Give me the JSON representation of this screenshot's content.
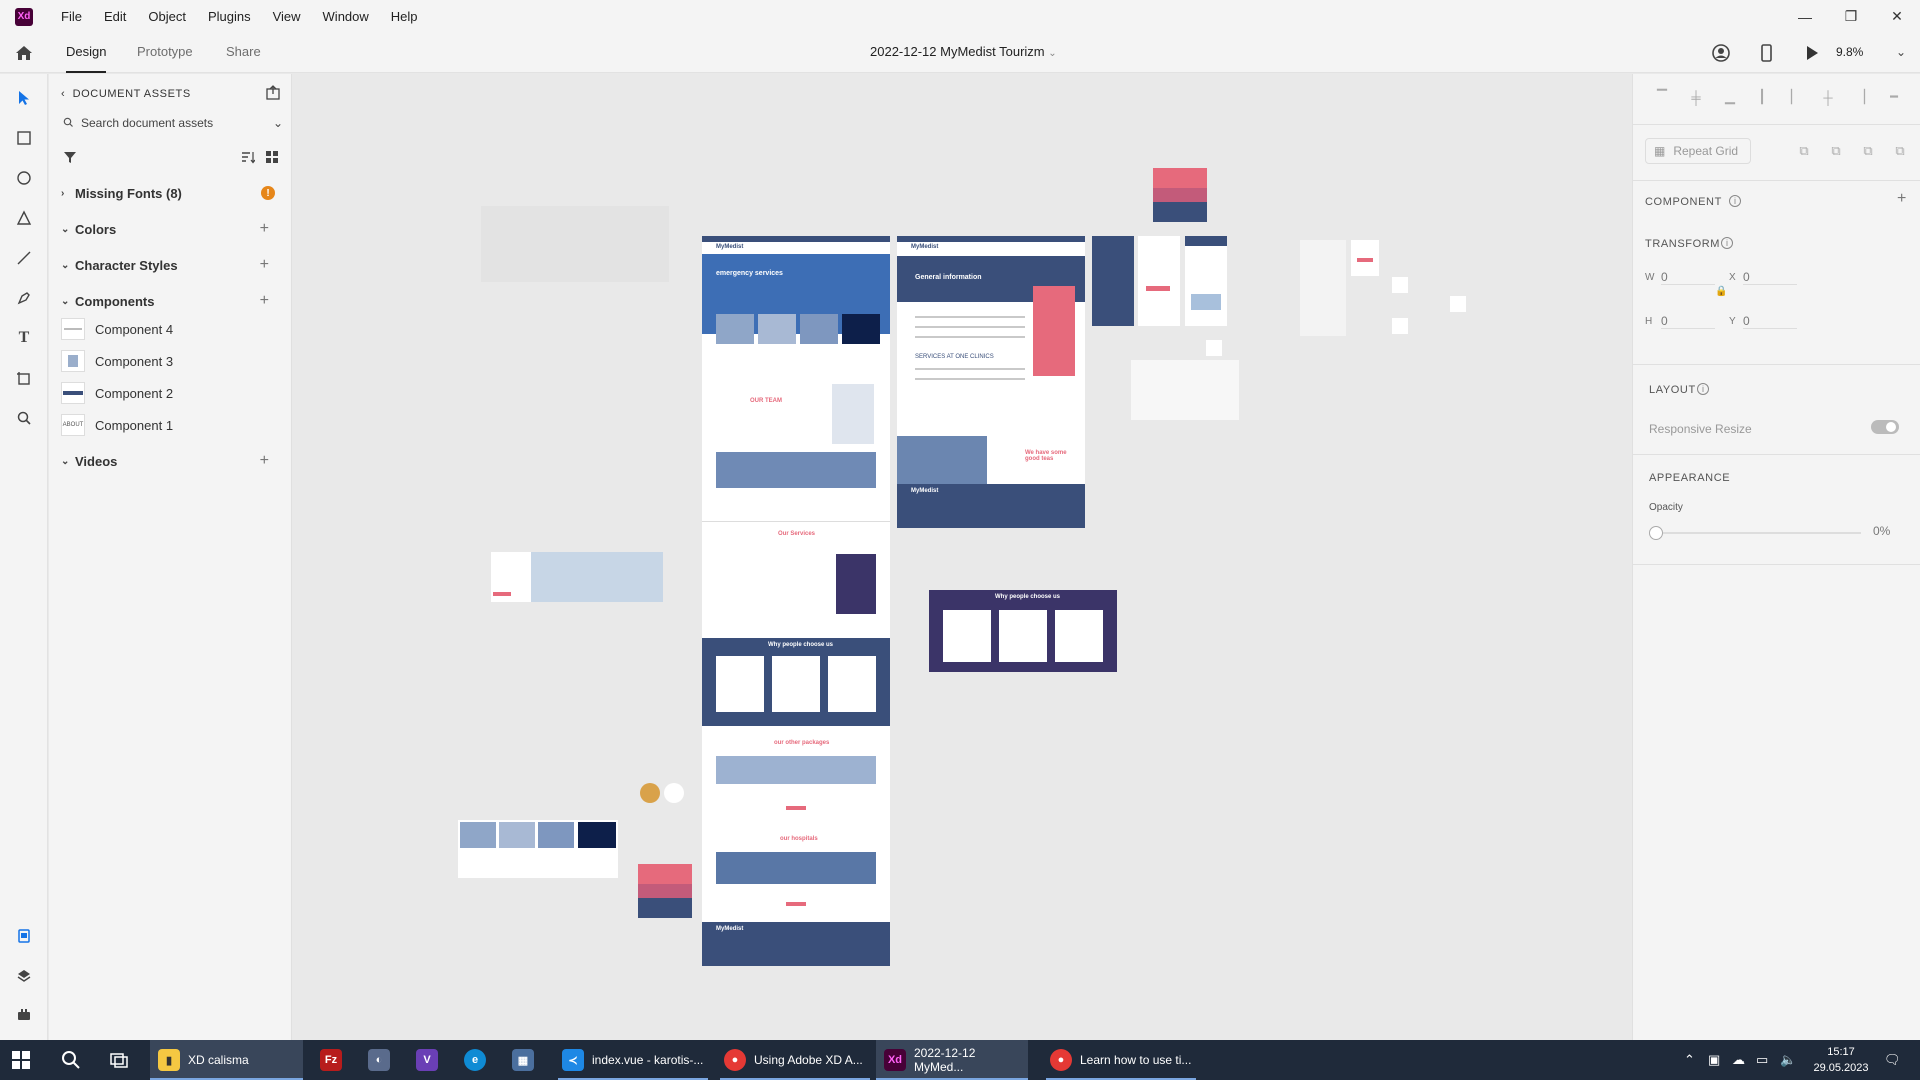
{
  "app": {
    "logo_text": "Xd",
    "menus": [
      "File",
      "Edit",
      "Object",
      "Plugins",
      "View",
      "Window",
      "Help"
    ],
    "window_controls": {
      "minimize": "—",
      "restore": "❐",
      "close": "✕"
    }
  },
  "topbar": {
    "tabs": [
      {
        "label": "Design",
        "active": true
      },
      {
        "label": "Prototype",
        "active": false
      },
      {
        "label": "Share",
        "active": false
      }
    ],
    "document_title": "2022-12-12 MyMedist Tourizm",
    "zoom": "9.8%"
  },
  "assets": {
    "header": "DOCUMENT ASSETS",
    "search_placeholder": "Search document assets",
    "missing_fonts": "Missing Fonts (8)",
    "sections": {
      "colors": "Colors",
      "character_styles": "Character Styles",
      "components": "Components",
      "videos": "Videos"
    },
    "components": [
      {
        "label": "Component 4",
        "thumb": ""
      },
      {
        "label": "Component 3",
        "thumb": ""
      },
      {
        "label": "Component 2",
        "thumb": ""
      },
      {
        "label": "Component 1",
        "thumb": "ABOUT"
      }
    ]
  },
  "canvas": {
    "artboard_texts": {
      "brand": "MyMedist",
      "emergency": "emergency services",
      "our_team": "OUR TEAM",
      "our_services": "Our Services",
      "why_choose": "Why people choose us",
      "other_packages": "our other packages",
      "hospitals": "our hospitals",
      "general_info": "General information",
      "services_clinics": "SERVICES AT ONE CLINICS",
      "we_have_some": "We have some good teas",
      "why_choose_2": "Why people choose us"
    }
  },
  "props": {
    "repeat_grid": "Repeat Grid",
    "component_label": "COMPONENT",
    "transform_label": "TRANSFORM",
    "w_label": "W",
    "w_value": "0",
    "h_label": "H",
    "h_value": "0",
    "x_label": "X",
    "x_value": "0",
    "y_label": "Y",
    "y_value": "0",
    "layout_label": "LAYOUT",
    "responsive_resize": "Responsive Resize",
    "appearance_label": "APPEARANCE",
    "opacity_label": "Opacity",
    "opacity_value": "0%"
  },
  "taskbar": {
    "apps": [
      {
        "label": "XD calisma",
        "icon": "folder"
      },
      {
        "label": "",
        "icon": "filezilla"
      },
      {
        "label": "",
        "icon": "app"
      },
      {
        "label": "",
        "icon": "visual-studio"
      },
      {
        "label": "",
        "icon": "edge"
      },
      {
        "label": "",
        "icon": "calculator"
      },
      {
        "label": "index.vue - karotis-...",
        "icon": "vscode"
      },
      {
        "label": "Using Adobe XD A...",
        "icon": "chrome"
      },
      {
        "label": "2022-12-12 MyMed...",
        "icon": "xd"
      },
      {
        "label": "Learn how to use ti...",
        "icon": "chrome"
      }
    ],
    "time": "15:17",
    "date": "29.05.2023"
  },
  "colors": {
    "xd_purple": "#470137",
    "pink": "#e66a7c",
    "navy": "#3a4f7a",
    "purple": "#3b3468",
    "taskbar": "#1f2a3a"
  }
}
